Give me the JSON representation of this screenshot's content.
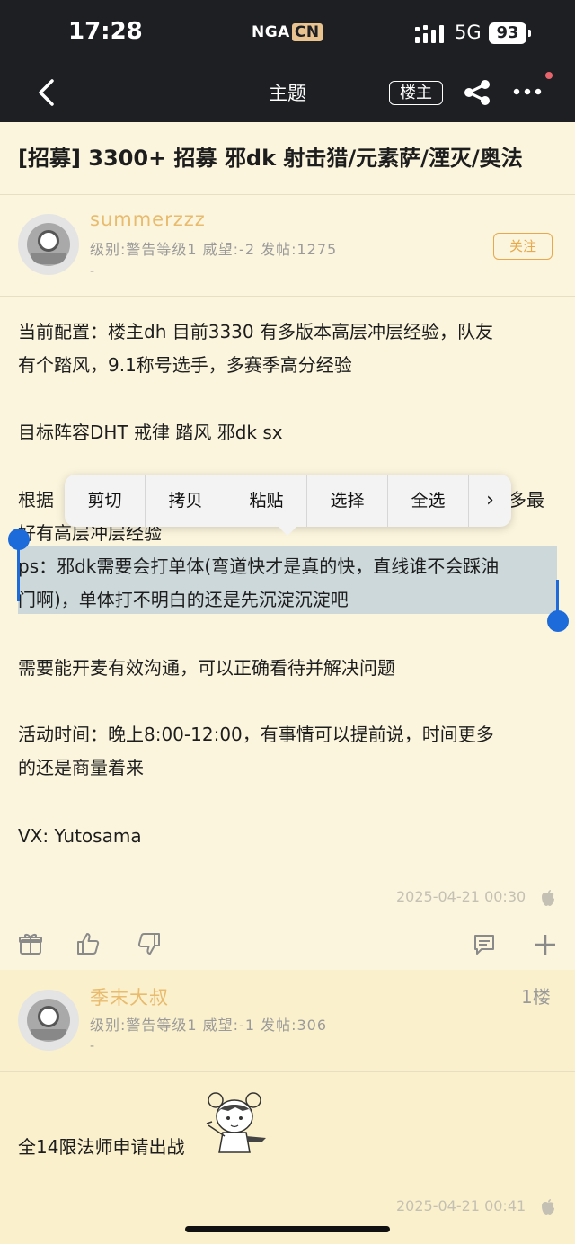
{
  "status": {
    "time": "17:28",
    "logo": "NGA",
    "logo_suffix": "CN",
    "network": "5G",
    "battery": "93"
  },
  "nav": {
    "title": "主题",
    "op_button": "楼主"
  },
  "topic": {
    "title": "[招募] 3300+ 招募 邪dk 射击猎/元素萨/湮灭/奥法"
  },
  "post": {
    "author": "summerzzz",
    "meta": "级别:警告等级1   威望:-2   发帖:1275",
    "sig": "-",
    "follow": "关注",
    "lines": {
      "l1": "当前配置：楼主dh 目前3330 有多版本高层冲层经验，队友",
      "l2": "有个踏风，9.1称号选手，多赛季高分经验",
      "l3": "目标阵容DHT 戒律 踏风 邪dk sx",
      "l4a": "根据",
      "l4b": "多最",
      "l5": "好有高层冲层经验",
      "l6": "ps：邪dk需要会打单体(弯道快才是真的快，直线谁不会踩油",
      "l7": "门啊)，单体打不明白的还是先沉淀沉淀吧",
      "l8": "需要能开麦有效沟通，可以正确看待并解决问题",
      "l9": "活动时间：晚上8:00-12:00，有事情可以提前说，时间更多",
      "l10": "的还是商量着来",
      "l11": "VX: Yutosama"
    },
    "timestamp": "2025-04-21 00:30"
  },
  "context_menu": {
    "items": [
      "剪切",
      "拷贝",
      "粘贴",
      "选择",
      "全选"
    ]
  },
  "reply": {
    "author": "季末大叔",
    "floor": "1楼",
    "meta": "级别:警告等级1   威望:-1   发帖:306",
    "sig": "-",
    "text": "全14限法师申请出战",
    "timestamp": "2025-04-21 00:41"
  },
  "icons": {
    "back": "chevron-left-icon",
    "share": "share-icon",
    "more": "more-icon",
    "gift": "gift-icon",
    "like": "thumbs-up-icon",
    "dislike": "thumbs-down-icon",
    "comment": "comment-icon",
    "add": "plus-icon",
    "apple": "apple-icon"
  },
  "colors": {
    "background": "#fbf5dd",
    "username": "#e8bb6e",
    "accent": "#e8a84b",
    "selection": "#1d6bdb"
  }
}
